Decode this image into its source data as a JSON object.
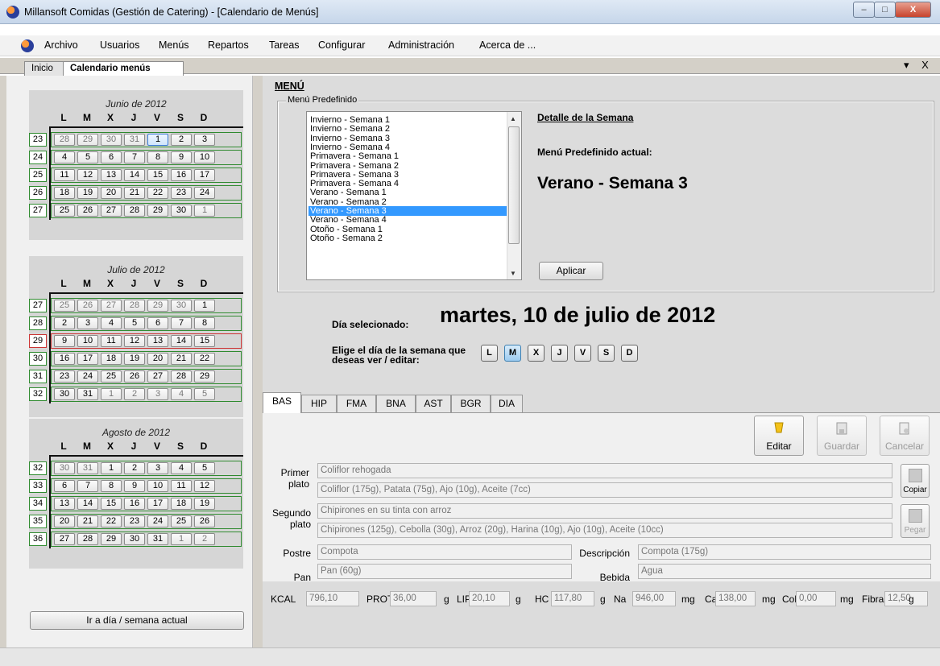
{
  "window": {
    "title": "Millansoft Comidas (Gestión de Catering) - [Calendario de Menús]",
    "controls": [
      "–",
      "□",
      "X"
    ]
  },
  "menu": [
    "Archivo",
    "Usuarios",
    "Menús",
    "Repartos",
    "Tareas",
    "Configurar",
    "Administración",
    "Acerca de ..."
  ],
  "doc_tabs": [
    {
      "label": "Inicio"
    },
    {
      "label": "Calendario menús"
    }
  ],
  "tab_controls": "▾ X",
  "calendars": [
    {
      "title": "Junio de 2012",
      "weekdays": [
        "L",
        "M",
        "X",
        "J",
        "V",
        "S",
        "D"
      ],
      "weeks": [
        {
          "num": "23",
          "days": [
            "28",
            "29",
            "30",
            "31",
            "1",
            "2",
            "3"
          ]
        },
        {
          "num": "24",
          "days": [
            "4",
            "5",
            "6",
            "7",
            "8",
            "9",
            "10"
          ]
        },
        {
          "num": "25",
          "days": [
            "11",
            "12",
            "13",
            "14",
            "15",
            "16",
            "17"
          ]
        },
        {
          "num": "26",
          "days": [
            "18",
            "19",
            "20",
            "21",
            "22",
            "23",
            "24"
          ]
        },
        {
          "num": "27",
          "days": [
            "25",
            "26",
            "27",
            "28",
            "29",
            "30",
            "1"
          ]
        }
      ]
    },
    {
      "title": "Julio de 2012",
      "weekdays": [
        "L",
        "M",
        "X",
        "J",
        "V",
        "S",
        "D"
      ],
      "weeks": [
        {
          "num": "27",
          "days": [
            "25",
            "26",
            "27",
            "28",
            "29",
            "30",
            "1"
          ]
        },
        {
          "num": "28",
          "days": [
            "2",
            "3",
            "4",
            "5",
            "6",
            "7",
            "8"
          ]
        },
        {
          "num": "29",
          "days": [
            "9",
            "10",
            "11",
            "12",
            "13",
            "14",
            "15"
          ]
        },
        {
          "num": "30",
          "days": [
            "16",
            "17",
            "18",
            "19",
            "20",
            "21",
            "22"
          ]
        },
        {
          "num": "31",
          "days": [
            "23",
            "24",
            "25",
            "26",
            "27",
            "28",
            "29"
          ]
        },
        {
          "num": "32",
          "days": [
            "30",
            "31",
            "1",
            "2",
            "3",
            "4",
            "5"
          ]
        }
      ]
    },
    {
      "title": "Agosto de 2012",
      "weekdays": [
        "L",
        "M",
        "X",
        "J",
        "V",
        "S",
        "D"
      ],
      "weeks": [
        {
          "num": "32",
          "days": [
            "30",
            "31",
            "1",
            "2",
            "3",
            "4",
            "5"
          ]
        },
        {
          "num": "33",
          "days": [
            "6",
            "7",
            "8",
            "9",
            "10",
            "11",
            "12"
          ]
        },
        {
          "num": "34",
          "days": [
            "13",
            "14",
            "15",
            "16",
            "17",
            "18",
            "19"
          ]
        },
        {
          "num": "35",
          "days": [
            "20",
            "21",
            "22",
            "23",
            "24",
            "25",
            "26"
          ]
        },
        {
          "num": "36",
          "days": [
            "27",
            "28",
            "29",
            "30",
            "31",
            "1",
            "2"
          ]
        }
      ]
    }
  ],
  "goto_button": "Ir a día / semana actual",
  "menu_section": {
    "heading": "MENÚ",
    "group_label": "Menú Predefinido",
    "list": [
      "Invierno - Semana 1",
      "Invierno - Semana 2",
      "Invierno - Semana 3",
      "Invierno - Semana 4",
      "Primavera - Semana 1",
      "Primavera - Semana 2",
      "Primavera - Semana 3",
      "Primavera - Semana 4",
      "Verano - Semana 1",
      "Verano - Semana 2",
      "Verano - Semana 3",
      "Verano - Semana 4",
      "Otoño - Semana 1",
      "Otoño - Semana 2"
    ],
    "selected": "Verano - Semana 3",
    "detail_link": "Detalle de la Semana",
    "current_label": "Menú Predefinido actual:",
    "current_value": "Verano - Semana 3",
    "apply_button": "Aplicar"
  },
  "selected_day": {
    "label": "Día selecionado:",
    "value": "martes, 10 de julio de 2012"
  },
  "day_chooser": {
    "label": "Elige el día de la semana que deseas ver / editar:",
    "days": [
      "L",
      "M",
      "X",
      "J",
      "V",
      "S",
      "D"
    ],
    "selected": "M"
  },
  "diet_tabs": [
    "BAS",
    "HIP",
    "FMA",
    "BNA",
    "AST",
    "BGR",
    "DIA"
  ],
  "actions": {
    "edit": "Editar",
    "save": "Guardar",
    "cancel": "Cancelar",
    "copy": "Copiar",
    "paste": "Pegar"
  },
  "form": {
    "primer_label_1": "Primer",
    "primer_label_2": "plato",
    "primer_name": "Coliflor rehogada",
    "primer_detail": "Coliflor (175g), Patata (75g), Ajo (10g), Aceite (7cc)",
    "segundo_label_1": "Segundo",
    "segundo_label_2": "plato",
    "segundo_name": "Chipirones en su tinta con arroz",
    "segundo_detail": "Chipirones (125g), Cebolla (30g), Arroz (20g), Harina (10g), Ajo (10g), Aceite (10cc)",
    "postre_label": "Postre",
    "postre": "Compota",
    "descripcion_label": "Descripción",
    "descripcion": "Compota (175g)",
    "pan_label": "Pan",
    "pan": "Pan (60g)",
    "bebida_label": "Bebida",
    "bebida": "Agua"
  },
  "nutrition": [
    {
      "label": "KCAL",
      "value": "796,10",
      "unit": ""
    },
    {
      "label": "PROT",
      "value": "36,00",
      "unit": "g"
    },
    {
      "label": "LIP",
      "value": "20,10",
      "unit": "g"
    },
    {
      "label": "HC",
      "value": "117,80",
      "unit": "g"
    },
    {
      "label": "Na",
      "value": "946,00",
      "unit": "mg"
    },
    {
      "label": "Ca",
      "value": "138,00",
      "unit": "mg"
    },
    {
      "label": "Col",
      "value": "0,00",
      "unit": "mg"
    },
    {
      "label": "Fibra",
      "value": "12,50",
      "unit": "g"
    }
  ],
  "colors": {
    "week_border": "#2f8a2f",
    "current_week_border": "#cc3333",
    "selection": "#3399ff"
  }
}
